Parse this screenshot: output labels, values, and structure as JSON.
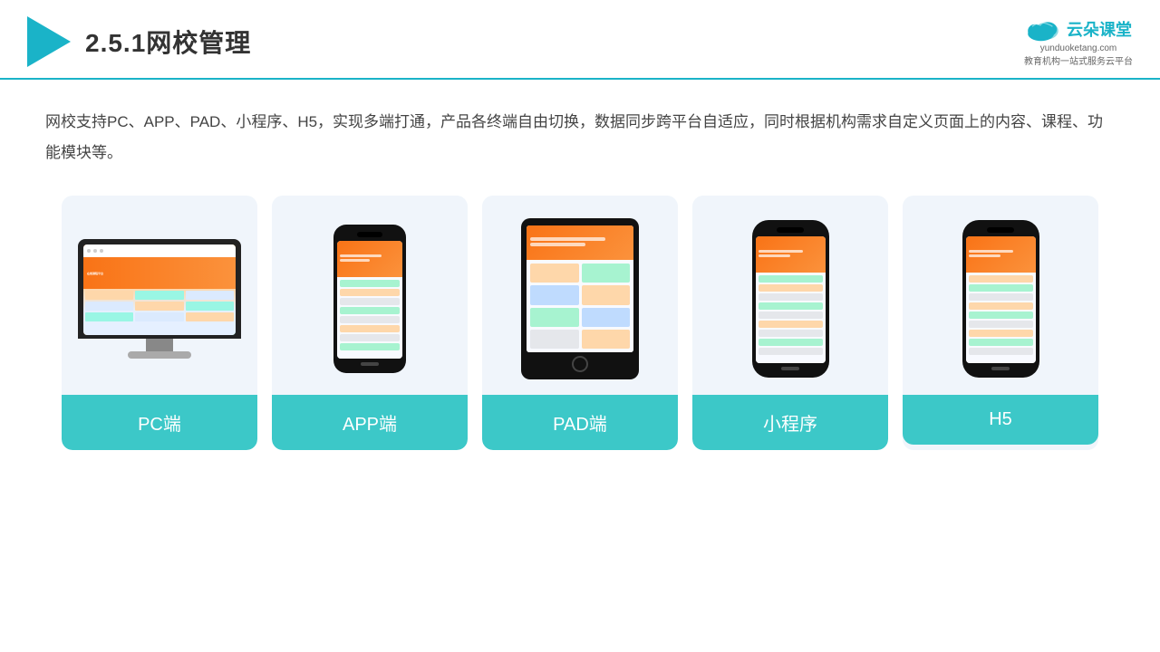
{
  "header": {
    "section_number": "2.5.1",
    "title": "网校管理",
    "brand": {
      "name": "云朵课堂",
      "domain": "yunduoketang.com",
      "tagline": "教育机构一站式服务云平台"
    }
  },
  "content": {
    "description": "网校支持PC、APP、PAD、小程序、H5，实现多端打通，产品各终端自由切换，数据同步跨平台自适应，同时根据机构需求自定义页面上的内容、课程、功能模块等。",
    "cards": [
      {
        "id": "pc",
        "label": "PC端"
      },
      {
        "id": "app",
        "label": "APP端"
      },
      {
        "id": "pad",
        "label": "PAD端"
      },
      {
        "id": "miniprogram",
        "label": "小程序"
      },
      {
        "id": "h5",
        "label": "H5"
      }
    ]
  },
  "colors": {
    "teal": "#3cc8c8",
    "accent": "#1ab3c8"
  }
}
